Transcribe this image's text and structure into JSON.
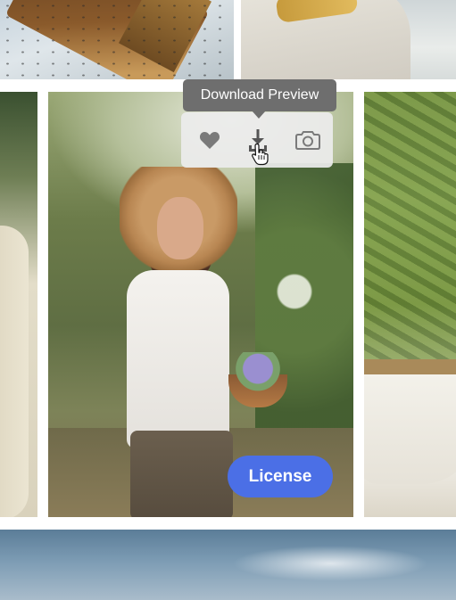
{
  "tooltip": {
    "text": "Download Preview"
  },
  "toolbar": {
    "items": [
      {
        "icon": "heart-icon"
      },
      {
        "icon": "download-icon"
      },
      {
        "icon": "camera-icon"
      }
    ],
    "icon_color": "#7a7a7a"
  },
  "license_button": {
    "label": "License",
    "color": "#4b6fe6"
  },
  "cursor": {
    "icon": "hand-pointer-icon"
  }
}
